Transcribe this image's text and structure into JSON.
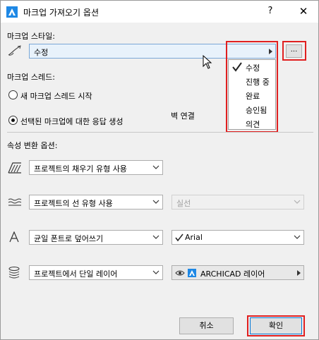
{
  "window": {
    "title": "마크업 가져오기 옵션",
    "help_label": "?",
    "close_label": "✕"
  },
  "markup_style": {
    "label": "마크업 스타일:",
    "selected": "수정",
    "more_button_label": "...",
    "menu_items": [
      "수정",
      "진행 중",
      "완료",
      "승인됨",
      "의견"
    ],
    "checked_index": 0
  },
  "markup_thread": {
    "label": "마크업 스레드:",
    "options": [
      "새 마크업 스레드 시작",
      "선택된 마크업에 대한 응답 생성"
    ],
    "selected_index": 1,
    "wall_link_label": "벽 연결"
  },
  "attribute_conversion": {
    "label": "속성 변환 옵션:",
    "fill": {
      "value": "프로젝트의 채우기 유형 사용"
    },
    "line": {
      "value": "프로젝트의 선 유형 사용",
      "line_type": "실선"
    },
    "font": {
      "value": "균일 폰트로 덮어쓰기",
      "font_name": "Arial"
    },
    "layer": {
      "value": "프로젝트에서 단일 레이어",
      "layer_name": "ARCHICAD 레이어"
    }
  },
  "footer": {
    "cancel_label": "취소",
    "ok_label": "확인"
  },
  "colors": {
    "highlight_red": "#e02020",
    "combo_blue": "#e8f2fb",
    "app_icon_blue": "#1e88e5"
  },
  "icons": {
    "app": "archicad-app-icon",
    "style": "pen-style-icon",
    "fill": "fill-pattern-icon",
    "line": "line-type-icon",
    "font": "font-icon",
    "layer": "layer-stack-icon",
    "eye": "eye-icon",
    "check": "checkmark-icon"
  }
}
